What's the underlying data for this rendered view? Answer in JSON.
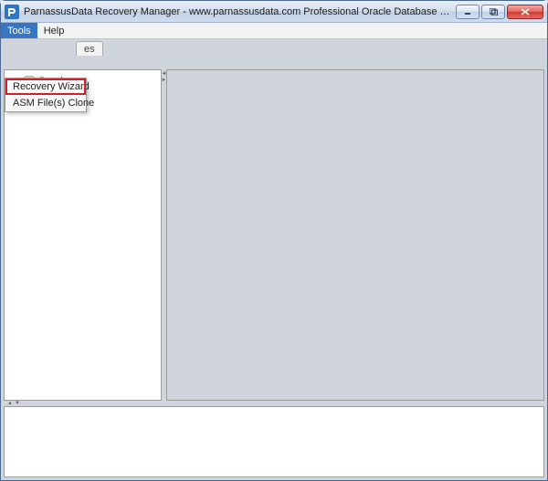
{
  "window": {
    "title": "ParnassusData Recovery Manager - www.parnassusdata.com  Professional Oracle Database Disaster Recovery"
  },
  "menubar": {
    "tools": "Tools",
    "help": "Help"
  },
  "tools_menu": {
    "recovery_wizard": "Recovery Wizard",
    "asm_files_clone": "ASM File(s) Clone"
  },
  "tabs": {
    "active": "es"
  },
  "tree": {
    "database": "Database"
  }
}
